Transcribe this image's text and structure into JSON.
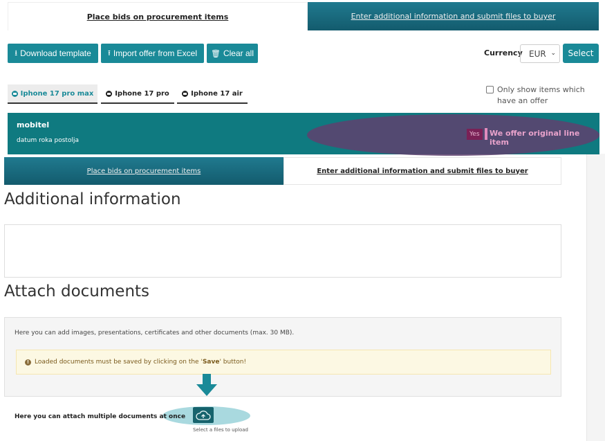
{
  "top_tabs": {
    "bids": "Place bids on procurement items",
    "additional": "Enter additional information and submit files to buyer"
  },
  "toolbar": {
    "download_template": "Download template",
    "import_offer": "Import offer from Excel",
    "clear_all": "Clear all",
    "currency_label": "Currency",
    "currency_value": "EUR",
    "select_button": "Select"
  },
  "product_tabs": [
    {
      "label": "Iphone 17 pro max",
      "active": true
    },
    {
      "label": "Iphone 17 pro",
      "active": false
    },
    {
      "label": "Iphone 17 air",
      "active": false
    }
  ],
  "filter": {
    "only_show_label": "Only show items which have an offer",
    "checked": false
  },
  "item": {
    "name": "mobitel",
    "description": "datum roka postolja",
    "offer_toggle_state": "Yes",
    "offer_label": "We offer original line item"
  },
  "second_tabs": {
    "bids": "Place bids on procurement items",
    "additional": "Enter additional information and submit files to buyer"
  },
  "additional_info": {
    "heading": "Additional information",
    "value": ""
  },
  "attach": {
    "heading": "Attach documents",
    "info_text": "Here you can add images, presentations, certificates and other documents (max. 30 MB).",
    "warning_prefix": "Loaded documents must be saved by clicking on the '",
    "warning_bold": "Save",
    "warning_suffix": "' button!",
    "multiple_label": "Here you can attach multiple documents at once",
    "upload_caption": "Select a files to upload"
  },
  "colors": {
    "teal": "#1a8a98",
    "dark_teal": "#0f7a80",
    "header_gradient": "#135b6d",
    "highlight_purple": "#5f416e",
    "highlight_cyan": "#a9d9df"
  },
  "icons": [
    "download-icon",
    "upload-icon",
    "trash-icon",
    "chevron-down-icon",
    "circle-arrow-icon",
    "exclamation-icon",
    "arrow-down-icon",
    "cloud-upload-icon"
  ]
}
